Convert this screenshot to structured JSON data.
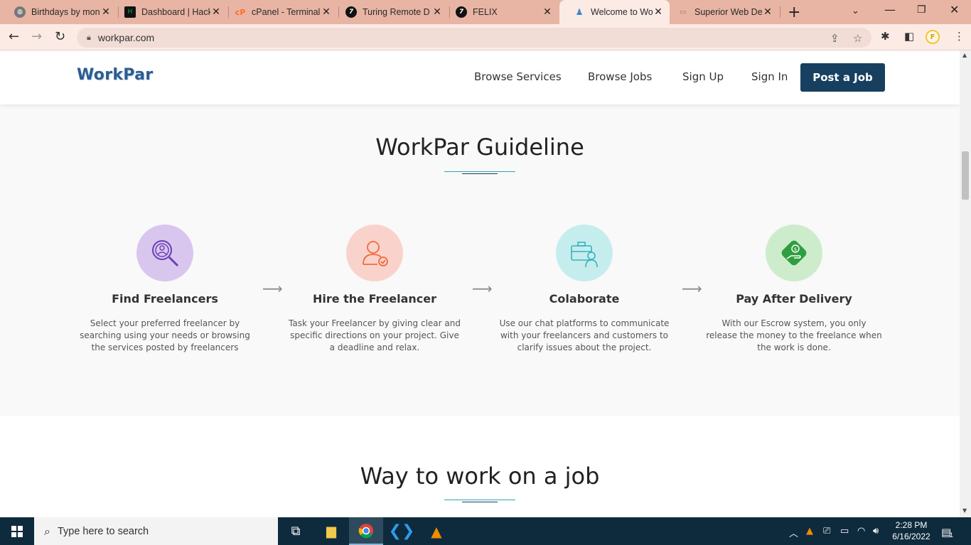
{
  "browser": {
    "tabs": [
      {
        "title": "Birthdays by mon",
        "icon": "globe-icon",
        "active": false
      },
      {
        "title": "Dashboard | Hack",
        "icon": "hackerrank-icon",
        "active": false
      },
      {
        "title": "cPanel - Terminal",
        "icon": "cpanel-icon",
        "active": false
      },
      {
        "title": "Turing Remote D",
        "icon": "turing-icon",
        "active": false
      },
      {
        "title": "FELIX",
        "icon": "turing-icon",
        "active": false
      },
      {
        "title": "Welcome to Wor",
        "icon": "workpar-icon",
        "active": true
      },
      {
        "title": "Superior Web De",
        "icon": "web-icon",
        "active": false
      }
    ],
    "url": "workpar.com",
    "profile_initial": "F"
  },
  "site": {
    "logo": "WorkPar",
    "nav": {
      "browse_services": "Browse Services",
      "browse_jobs": "Browse Jobs",
      "sign_up": "Sign Up",
      "sign_in": "Sign In",
      "post_job": "Post a Job"
    },
    "guideline": {
      "title": "WorkPar Guideline",
      "steps": [
        {
          "title": "Find Freelancers",
          "description": "Select your preferred freelancer by searching using your needs or browsing the services posted by freelancers",
          "icon": "search-person-icon",
          "color": "#d9c6ef"
        },
        {
          "title": "Hire the Freelancer",
          "description": "Task your Freelancer by giving clear and specific directions on your project. Give a deadline and relax.",
          "icon": "hire-person-icon",
          "color": "#f9d3cb"
        },
        {
          "title": "Colaborate",
          "description": "Use our chat platforms to communicate with your freelancers and customers to clarify issues about the project.",
          "icon": "briefcase-person-icon",
          "color": "#c6eded"
        },
        {
          "title": "Pay After Delivery",
          "description": "With our Escrow system, you only release the money to the freelance when the work is done.",
          "icon": "payment-icon",
          "color": "#cdeccc"
        }
      ]
    },
    "way_to_work": {
      "title": "Way to work on a job"
    }
  },
  "taskbar": {
    "search_placeholder": "Type here to search",
    "time": "2:28 PM",
    "date": "6/16/2022",
    "notification_count": "1"
  }
}
